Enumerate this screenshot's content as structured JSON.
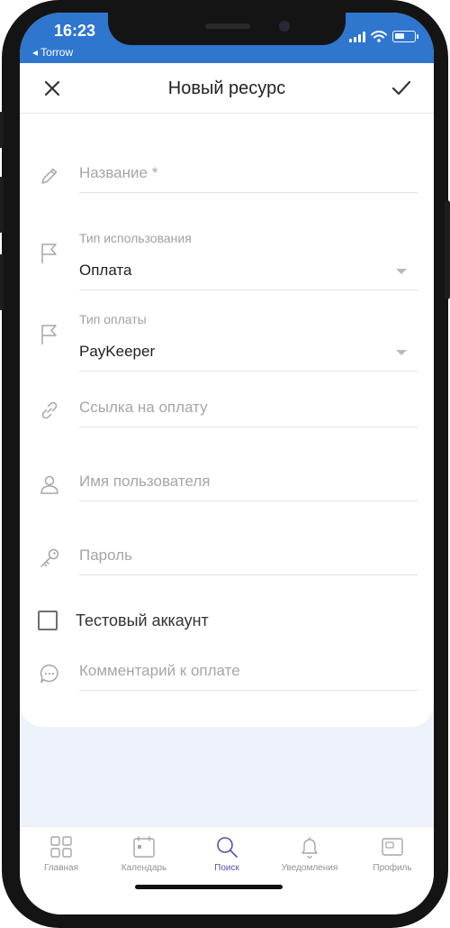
{
  "status_bar": {
    "time": "16:23",
    "back_app": "◂ Torrow"
  },
  "header": {
    "title": "Новый ресурс"
  },
  "form": {
    "name_placeholder": "Название *",
    "usage_type_label": "Тип использования",
    "usage_type_value": "Оплата",
    "payment_type_label": "Тип оплаты",
    "payment_type_value": "PayKeeper",
    "payment_link_placeholder": "Ссылка на оплату",
    "username_placeholder": "Имя пользователя",
    "password_placeholder": "Пароль",
    "test_account_label": "Тестовый аккаунт",
    "test_account_checked": false,
    "comment_placeholder": "Комментарий к оплате"
  },
  "tabbar": {
    "items": [
      {
        "label": "Главная",
        "icon": "grid-icon"
      },
      {
        "label": "Календарь",
        "icon": "calendar-icon"
      },
      {
        "label": "Поиск",
        "icon": "search-icon",
        "active": true
      },
      {
        "label": "Уведомления",
        "icon": "bell-icon"
      },
      {
        "label": "Профиль",
        "icon": "profile-icon"
      }
    ]
  },
  "colors": {
    "status_bar": "#2f76cf",
    "active_tab": "#5a4fa8",
    "background": "#eef3fb"
  }
}
